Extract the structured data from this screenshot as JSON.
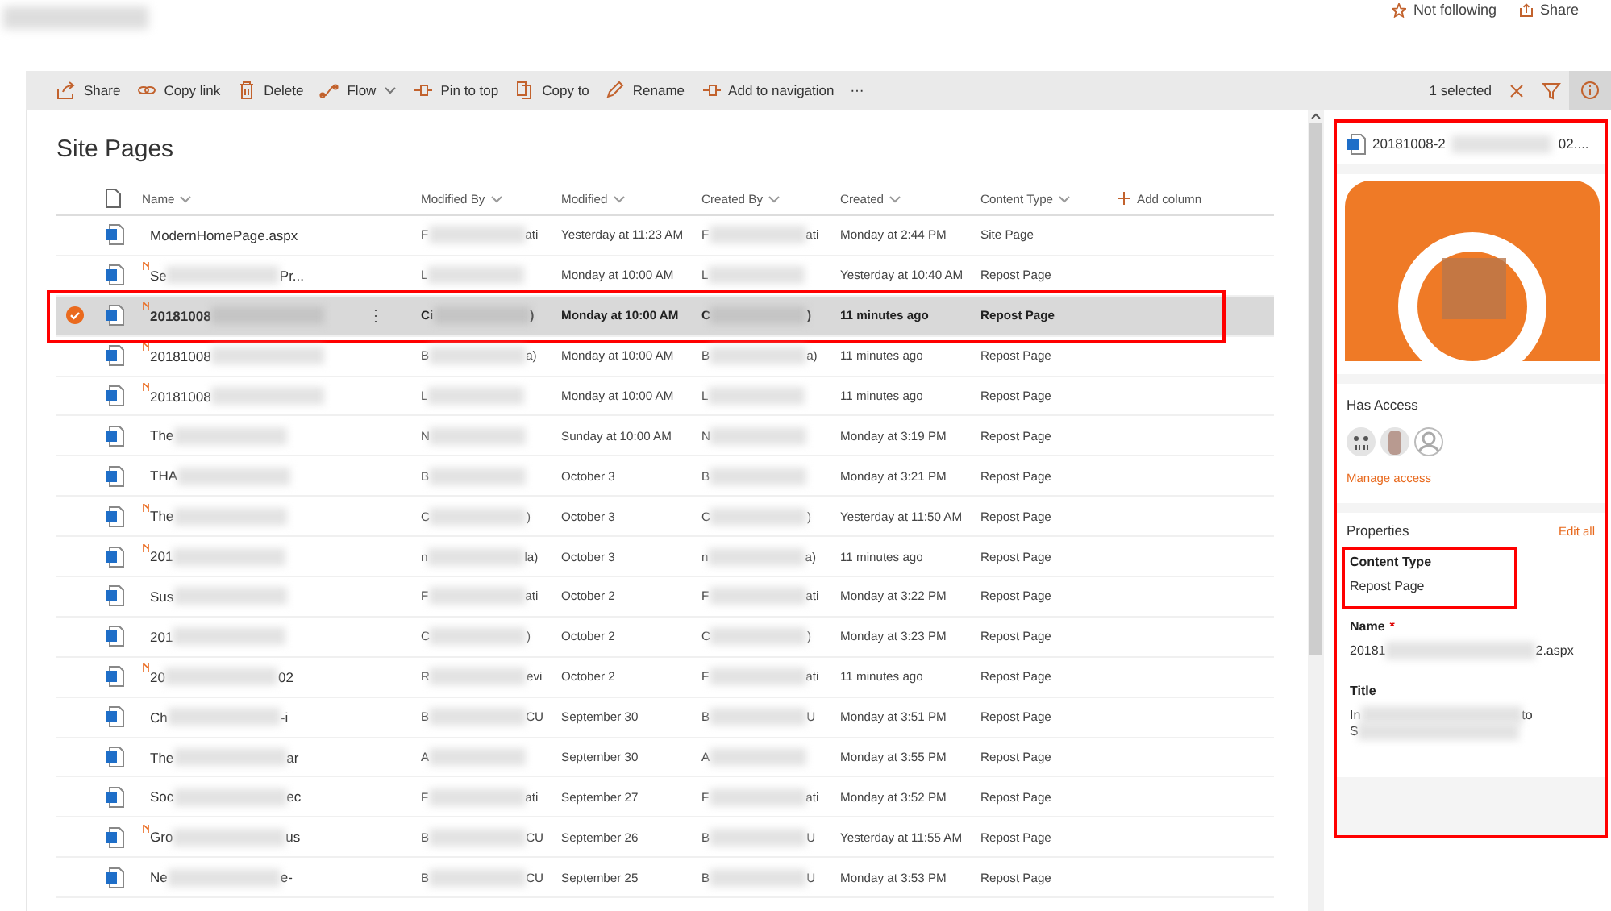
{
  "header": {
    "follow": "Not following",
    "share": "Share"
  },
  "toolbar": {
    "commands": [
      {
        "label": "Share",
        "dropdown": false
      },
      {
        "label": "Copy link",
        "dropdown": false
      },
      {
        "label": "Delete",
        "dropdown": false
      },
      {
        "label": "Flow",
        "dropdown": true
      },
      {
        "label": "Pin to top",
        "dropdown": false
      },
      {
        "label": "Copy to",
        "dropdown": false
      },
      {
        "label": "Rename",
        "dropdown": false
      },
      {
        "label": "Add to navigation",
        "dropdown": false
      },
      {
        "label": "⋯",
        "dropdown": false
      }
    ],
    "selection": "1 selected",
    "details_selected": true
  },
  "library": {
    "title": "Site Pages",
    "columns": [
      "Name",
      "Modified By",
      "Modified",
      "Created By",
      "Created",
      "Content Type"
    ],
    "add_column": "Add column",
    "rows": [
      {
        "name": "ModernHomePage.aspx",
        "new": false,
        "selected": false,
        "annotated": false,
        "modified_by": "F",
        "modified_by_tail": "ati",
        "modified": "Yesterday at 11:23 AM",
        "created_by": "F",
        "created_by_tail": "ati",
        "created": "Monday at 2:44 PM",
        "content_type": "Site Page"
      },
      {
        "name": "Se",
        "name_tail": "Pr...",
        "new": true,
        "selected": false,
        "annotated": false,
        "modified_by": "L",
        "modified": "Monday at 10:00 AM",
        "created_by": "L",
        "created": "Yesterday at 10:40 AM",
        "content_type": "Repost Page"
      },
      {
        "name": "20181008",
        "menu": "⋮",
        "new": true,
        "selected": true,
        "annotated": true,
        "modified_by": "Ci",
        "modified_by_tail": ")",
        "modified": "Monday at 10:00 AM",
        "created_by": "C",
        "created_by_tail": ")",
        "created": "11 minutes ago",
        "content_type": "Repost Page"
      },
      {
        "name": "20181008",
        "new": true,
        "selected": false,
        "annotated": false,
        "modified_by": "B",
        "modified_by_tail": "a)",
        "modified": "Monday at 10:00 AM",
        "created_by": "B",
        "created_by_tail": "a)",
        "created": "11 minutes ago",
        "content_type": "Repost Page"
      },
      {
        "name": "20181008",
        "new": true,
        "selected": false,
        "annotated": false,
        "modified_by": "L",
        "modified": "Monday at 10:00 AM",
        "created_by": "L",
        "created": "11 minutes ago",
        "content_type": "Repost Page"
      },
      {
        "name": "The",
        "new": false,
        "selected": false,
        "annotated": false,
        "modified_by": "N",
        "modified": "Sunday at 10:00 AM",
        "created_by": "N",
        "created": "Monday at 3:19 PM",
        "content_type": "Repost Page"
      },
      {
        "name": "THA",
        "new": false,
        "selected": false,
        "annotated": false,
        "modified_by": "B",
        "modified": "October 3",
        "created_by": "B",
        "created": "Monday at 3:21 PM",
        "content_type": "Repost Page"
      },
      {
        "name": "The",
        "new": true,
        "selected": false,
        "annotated": false,
        "modified_by": "C",
        "modified_by_tail": ")",
        "modified": "October 3",
        "created_by": "C",
        "created_by_tail": ")",
        "created": "Yesterday at 11:50 AM",
        "content_type": "Repost Page"
      },
      {
        "name": "201",
        "new": true,
        "selected": false,
        "annotated": false,
        "modified_by": "n",
        "modified_by_tail": "la)",
        "modified": "October 3",
        "created_by": "n",
        "created_by_tail": "a)",
        "created": "11 minutes ago",
        "content_type": "Repost Page"
      },
      {
        "name": "Sus",
        "new": false,
        "selected": false,
        "annotated": false,
        "modified_by": "F",
        "modified_by_tail": "ati",
        "modified": "October 2",
        "created_by": "F",
        "created_by_tail": "ati",
        "created": "Monday at 3:22 PM",
        "content_type": "Repost Page"
      },
      {
        "name": "201",
        "new": false,
        "selected": false,
        "annotated": false,
        "modified_by": "C",
        "modified_by_tail": ")",
        "modified": "October 2",
        "created_by": "C",
        "created_by_tail": ")",
        "created": "Monday at 3:23 PM",
        "content_type": "Repost Page"
      },
      {
        "name": "20",
        "name_tail": "02",
        "new": true,
        "selected": false,
        "annotated": false,
        "modified_by": "R",
        "modified_by_tail": "evi",
        "modified": "October 2",
        "created_by": "F",
        "created_by_tail": "ati",
        "created": "11 minutes ago",
        "content_type": "Repost Page"
      },
      {
        "name": "Ch",
        "name_tail": "-i",
        "new": false,
        "selected": false,
        "annotated": false,
        "modified_by": "B",
        "modified_by_tail": "CU",
        "modified": "September 30",
        "created_by": "B",
        "created_by_tail": "U",
        "created": "Monday at 3:51 PM",
        "content_type": "Repost Page"
      },
      {
        "name": "The",
        "name_tail": "ar",
        "new": false,
        "selected": false,
        "annotated": false,
        "modified_by": "A",
        "modified": "September 30",
        "created_by": "A",
        "created": "Monday at 3:55 PM",
        "content_type": "Repost Page"
      },
      {
        "name": "Soc",
        "name_tail": "ec",
        "new": false,
        "selected": false,
        "annotated": false,
        "modified_by": "F",
        "modified_by_tail": "ati",
        "modified": "September 27",
        "created_by": "F",
        "created_by_tail": "ati",
        "created": "Monday at 3:52 PM",
        "content_type": "Repost Page"
      },
      {
        "name": "Gro",
        "name_tail": "us",
        "new": true,
        "selected": false,
        "annotated": false,
        "modified_by": "B",
        "modified_by_tail": "CU",
        "modified": "September 26",
        "created_by": "B",
        "created_by_tail": "U",
        "created": "Yesterday at 11:55 AM",
        "content_type": "Repost Page"
      },
      {
        "name": "Ne",
        "name_tail": "e-",
        "new": false,
        "selected": false,
        "annotated": false,
        "modified_by": "B",
        "modified_by_tail": "CU",
        "modified": "September 25",
        "created_by": "B",
        "created_by_tail": "U",
        "created": "Monday at 3:53 PM",
        "content_type": "Repost Page"
      }
    ]
  },
  "details_panel": {
    "annotated": true,
    "file_name": "20181008-2",
    "file_name_tail": "02....",
    "has_access": {
      "title": "Has Access",
      "manage": "Manage access"
    },
    "properties": {
      "title": "Properties",
      "edit_all": "Edit all",
      "fields": [
        {
          "label": "Content Type",
          "annotated": true,
          "lines": [
            {
              "text": "Repost Page"
            }
          ]
        },
        {
          "label": "Name",
          "required_mark": "*",
          "annotated": false,
          "lines": [
            {
              "text": "20181",
              "tail": "2.aspx"
            }
          ]
        },
        {
          "label": "Title",
          "annotated": false,
          "lines": [
            {
              "text": "In",
              "tail": "to"
            },
            {
              "text": "S"
            }
          ]
        }
      ]
    }
  }
}
